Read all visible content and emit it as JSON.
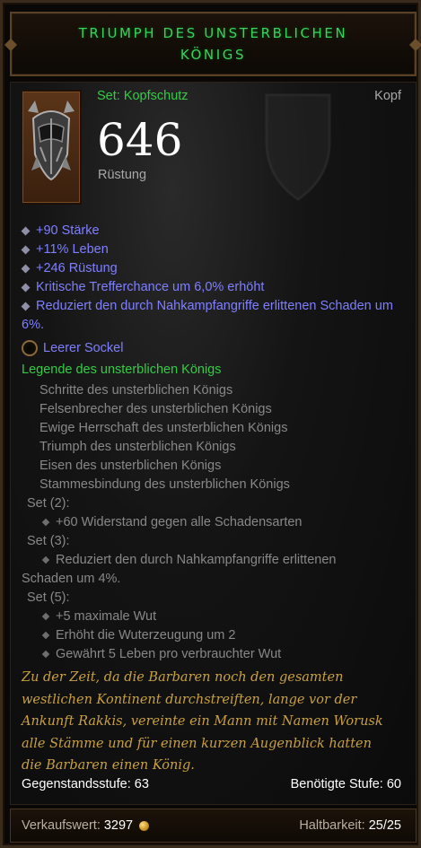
{
  "header": {
    "title_line1": "TRIUMPH DES UNSTERBLICHEN",
    "title_line2": "KÖNIGS"
  },
  "item": {
    "set_type": "Set: Kopfschutz",
    "slot": "Kopf",
    "armor_value": "646",
    "armor_label": "Rüstung",
    "icon": "helmet-icon"
  },
  "affixes": [
    "+90 Stärke",
    "+11% Leben",
    "+246 Rüstung",
    "Kritische Trefferchance um 6,0% erhöht",
    "Reduziert den durch Nahkampfangriffe erlittenen Schaden um 6%."
  ],
  "socket": {
    "label": "Leerer Sockel"
  },
  "set": {
    "title": "Legende des unsterblichen Königs",
    "items": [
      "Schritte des unsterblichen Königs",
      "Felsenbrecher des unsterblichen Königs",
      "Ewige Herrschaft des unsterblichen Königs",
      "Triumph des unsterblichen Königs",
      "Eisen des unsterblichen Königs",
      "Stammesbindung des unsterblichen Königs"
    ],
    "bonus2": {
      "head": "Set (2):",
      "rows": [
        "+60 Widerstand gegen alle Schadensarten"
      ]
    },
    "bonus3": {
      "head": "Set (3):",
      "row_line1": "Reduziert den durch Nahkampfangriffe erlittenen",
      "row_line2": "Schaden um 4%."
    },
    "bonus5": {
      "head": "Set (5):",
      "rows": [
        "+5 maximale Wut",
        "Erhöht die Wuterzeugung um 2",
        "Gewährt 5 Leben pro verbrauchter Wut"
      ]
    }
  },
  "flavor": {
    "line1": "Zu der Zeit, da die Barbaren noch den gesamten",
    "line2": "westlichen Kontinent durchstreiften, lange vor der",
    "line3": "Ankunft Rakkis, vereinte ein Mann mit Namen Worusk",
    "line4": "alle Stämme und für einen kurzen Augenblick hatten",
    "line5": "die Barbaren einen König."
  },
  "levels": {
    "item_level_label": "Gegenstandsstufe:",
    "item_level": "63",
    "required_label": "Benötigte Stufe:",
    "required": "60"
  },
  "footer": {
    "sell_label": "Verkaufswert:",
    "sell_value": "3297",
    "durability_label": "Haltbarkeit:",
    "durability_value": "25/25"
  },
  "colors": {
    "set_green": "#33cc44",
    "magic_blue": "#7f7fff",
    "flavor_gold": "#c8a040"
  }
}
